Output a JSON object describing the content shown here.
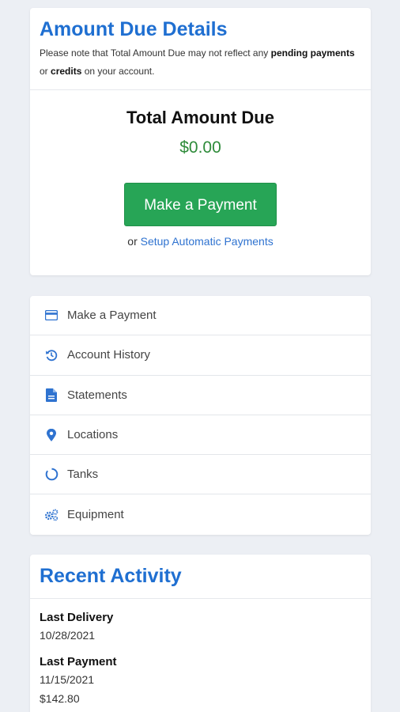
{
  "amount_due": {
    "title": "Amount Due Details",
    "note_prefix": "Please note that Total Amount Due may not reflect any",
    "note_bold_1": "pending payments",
    "note_mid": "or",
    "note_bold_2": "credits",
    "note_suffix": "on your account.",
    "total_label": "Total Amount Due",
    "total_value": "$0.00",
    "pay_button": "Make a Payment",
    "auto_prefix": "or",
    "auto_link": "Setup Automatic Payments"
  },
  "menu": {
    "items": [
      {
        "label": "Make a Payment",
        "icon": "credit-card-icon"
      },
      {
        "label": "Account History",
        "icon": "history-icon"
      },
      {
        "label": "Statements",
        "icon": "document-icon"
      },
      {
        "label": "Locations",
        "icon": "map-pin-icon"
      },
      {
        "label": "Tanks",
        "icon": "circle-icon"
      },
      {
        "label": "Equipment",
        "icon": "gears-icon"
      }
    ]
  },
  "recent": {
    "title": "Recent Activity",
    "last_delivery_label": "Last Delivery",
    "last_delivery_date": "10/28/2021",
    "last_payment_label": "Last Payment",
    "last_payment_date": "11/15/2021",
    "last_payment_amount": "$142.80"
  },
  "colors": {
    "accent": "#1f6fd1",
    "success": "#27a556",
    "money": "#2e8b3a",
    "background": "#eceff4"
  }
}
